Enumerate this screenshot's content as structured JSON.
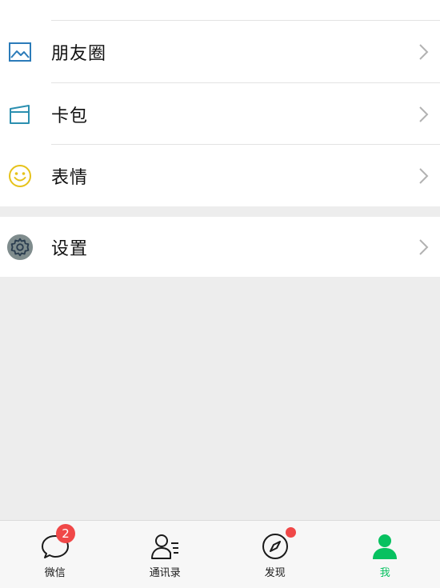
{
  "menu": {
    "items": [
      {
        "label": "朋友圈",
        "icon": "moments-image-icon",
        "icon_color": "#2b7bb9"
      },
      {
        "label": "卡包",
        "icon": "card-wallet-icon",
        "icon_color": "#2b8fb0"
      },
      {
        "label": "表情",
        "icon": "smiley-face-icon",
        "icon_color": "#e6c21a"
      }
    ],
    "settings": {
      "label": "设置",
      "icon": "gear-icon",
      "icon_color": "#5d6d7e"
    }
  },
  "tabbar": {
    "tabs": [
      {
        "label": "微信",
        "icon": "chat-bubble-icon",
        "badge": "2"
      },
      {
        "label": "通讯录",
        "icon": "contacts-icon"
      },
      {
        "label": "发现",
        "icon": "compass-icon",
        "dot": true
      },
      {
        "label": "我",
        "icon": "person-icon",
        "active": true
      }
    ],
    "active_color": "#07c160",
    "badge_color": "#f04848"
  }
}
